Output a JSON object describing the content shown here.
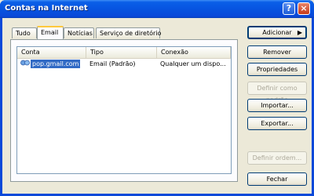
{
  "window": {
    "title": "Contas na Internet",
    "help_label": "?",
    "close_label": "×"
  },
  "tabs": [
    {
      "label": "Tudo"
    },
    {
      "label": "Email"
    },
    {
      "label": "Notícias"
    },
    {
      "label": "Serviço de diretório"
    }
  ],
  "active_tab": "Email",
  "table": {
    "columns": [
      "Conta",
      "Tipo",
      "Conexão"
    ],
    "rows": [
      {
        "account": "pop.gmail.com",
        "type": "Email (Padrão)",
        "connection": "Qualquer um dispo..."
      }
    ]
  },
  "buttons": {
    "add": "Adicionar",
    "add_arrow": "▶",
    "remove": "Remover",
    "properties": "Propriedades",
    "set_default": "Definir como padrão",
    "import": "Importar...",
    "export": "Exportar...",
    "set_order": "Definir ordem...",
    "close": "Fechar"
  },
  "icons": {
    "account": "account-icon"
  }
}
